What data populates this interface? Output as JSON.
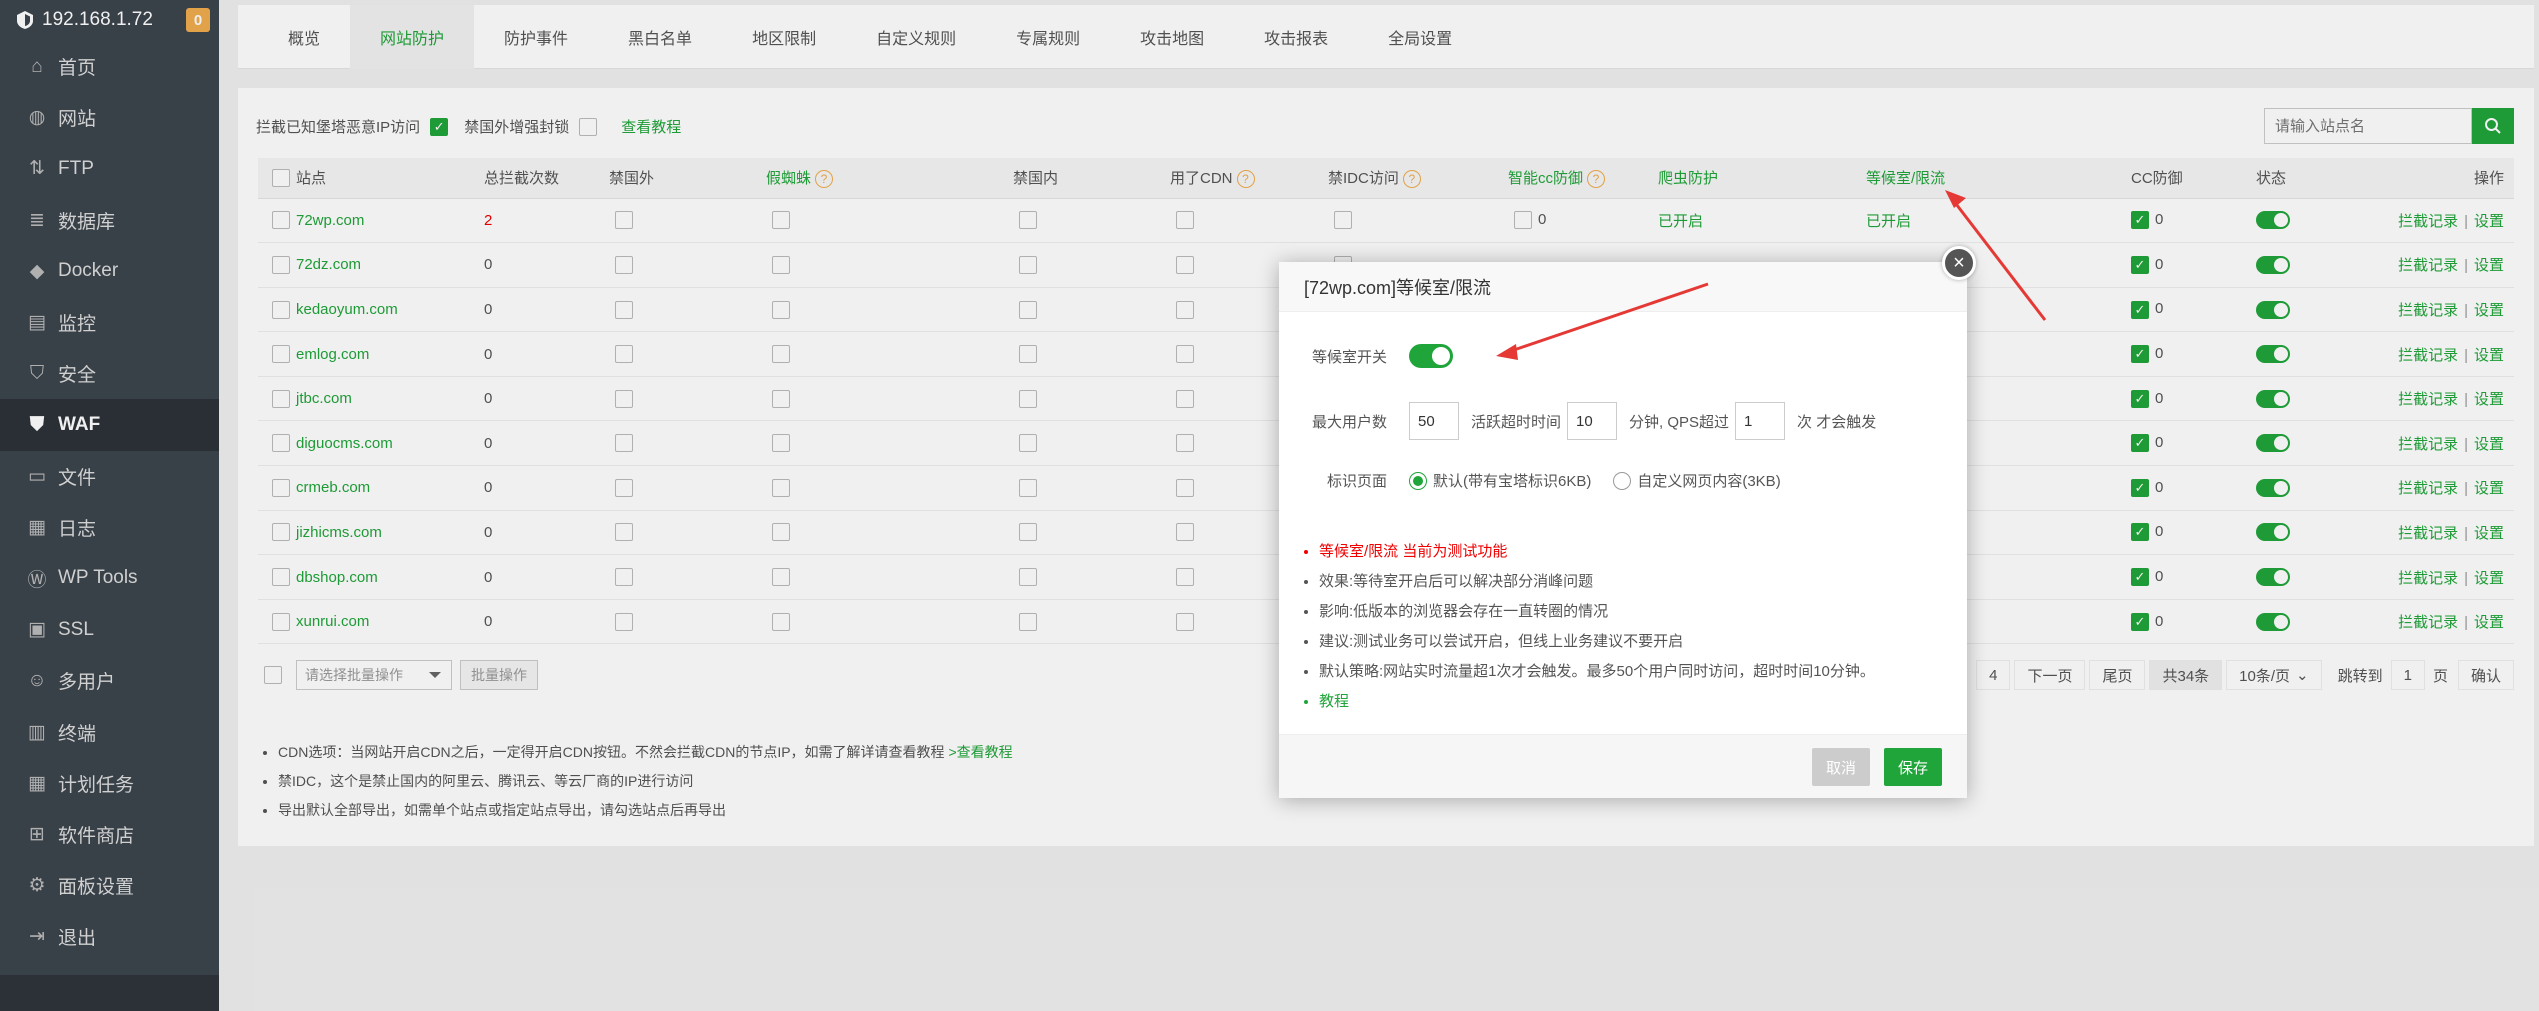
{
  "sidebar": {
    "host": "192.168.1.72",
    "badge": "0",
    "items": [
      {
        "label": "首页",
        "icon": "home-icon"
      },
      {
        "label": "网站",
        "icon": "globe-icon"
      },
      {
        "label": "FTP",
        "icon": "ftp-icon"
      },
      {
        "label": "数据库",
        "icon": "database-icon"
      },
      {
        "label": "Docker",
        "icon": "docker-icon"
      },
      {
        "label": "监控",
        "icon": "monitor-icon"
      },
      {
        "label": "安全",
        "icon": "shield-icon"
      },
      {
        "label": "WAF",
        "icon": "waf-icon"
      },
      {
        "label": "文件",
        "icon": "folder-icon"
      },
      {
        "label": "日志",
        "icon": "log-icon"
      },
      {
        "label": "WP Tools",
        "icon": "wordpress-icon"
      },
      {
        "label": "SSL",
        "icon": "ssl-icon"
      },
      {
        "label": "多用户",
        "icon": "users-icon"
      },
      {
        "label": "终端",
        "icon": "terminal-icon"
      },
      {
        "label": "计划任务",
        "icon": "calendar-icon"
      },
      {
        "label": "软件商店",
        "icon": "apps-icon"
      },
      {
        "label": "面板设置",
        "icon": "gear-icon"
      },
      {
        "label": "退出",
        "icon": "logout-icon"
      }
    ]
  },
  "tabs": [
    "概览",
    "网站防护",
    "防护事件",
    "黑白名单",
    "地区限制",
    "自定义规则",
    "专属规则",
    "攻击地图",
    "攻击报表",
    "全局设置"
  ],
  "toolbar": {
    "intercept_label": "拦截已知堡塔恶意IP访问",
    "overseas_label": "禁国外增强封锁",
    "tutorial_link": "查看教程",
    "search_placeholder": "请输入站点名"
  },
  "table": {
    "headers": [
      "站点",
      "总拦截次数",
      "禁国外",
      "假蜘蛛",
      "禁国内",
      "用了CDN",
      "禁IDC访问",
      "智能cc防御",
      "爬虫防护",
      "等候室/限流",
      "CC防御",
      "状态",
      "操作"
    ],
    "rows": [
      {
        "site": "72wp.com",
        "count": "2",
        "crawler": "已开启",
        "waiting": "已开启",
        "cc": "0",
        "smartcc": "0"
      },
      {
        "site": "72dz.com",
        "count": "0",
        "crawler": "",
        "waiting": "",
        "cc": "0",
        "smartcc": ""
      },
      {
        "site": "kedaoyum.com",
        "count": "0",
        "crawler": "",
        "waiting": "",
        "cc": "0",
        "smartcc": ""
      },
      {
        "site": "emlog.com",
        "count": "0",
        "crawler": "",
        "waiting": "",
        "cc": "0",
        "smartcc": ""
      },
      {
        "site": "jtbc.com",
        "count": "0",
        "crawler": "",
        "waiting": "",
        "cc": "0",
        "smartcc": ""
      },
      {
        "site": "diguocms.com",
        "count": "0",
        "crawler": "",
        "waiting": "",
        "cc": "0",
        "smartcc": ""
      },
      {
        "site": "crmeb.com",
        "count": "0",
        "crawler": "",
        "waiting": "",
        "cc": "0",
        "smartcc": ""
      },
      {
        "site": "jizhicms.com",
        "count": "0",
        "crawler": "",
        "waiting": "",
        "cc": "0",
        "smartcc": ""
      },
      {
        "site": "dbshop.com",
        "count": "0",
        "crawler": "",
        "waiting": "",
        "cc": "0",
        "smartcc": ""
      },
      {
        "site": "xunrui.com",
        "count": "0",
        "crawler": "",
        "waiting": "",
        "cc": "0",
        "smartcc": ""
      }
    ],
    "op_log": "拦截记录",
    "op_sep": "|",
    "op_settings": "设置"
  },
  "bottom": {
    "batch_placeholder": "请选择批量操作",
    "batch_button": "批量操作"
  },
  "pager": {
    "page": "4",
    "next": "下一页",
    "last": "尾页",
    "total": "共34条",
    "per_page": "10条/页",
    "jump_label": "跳转到",
    "jump_value": "1",
    "page_unit": "页",
    "confirm": "确认"
  },
  "notes": [
    "CDN选项：当网站开启CDN之后，一定得开启CDN按钮。不然会拦截CDN的节点IP，如需了解详请查看教程",
    "禁IDC，这个是禁止国内的阿里云、腾讯云、等云厂商的IP进行访问",
    "导出默认全部导出，如需单个站点或指定站点导出，请勾选站点后再导出"
  ],
  "notes_link": ">查看教程",
  "modal": {
    "title": "[72wp.com]等候室/限流",
    "close": "×",
    "switch_label": "等候室开关",
    "max_users_label": "最大用户数",
    "max_users_value": "50",
    "active_timeout_label": "活跃超时时间",
    "active_timeout_value": "10",
    "qps_label": "分钟, QPS超过",
    "qps_value": "1",
    "trigger_label": "次 才会触发",
    "page_label": "标识页面",
    "radio_default": "默认(带有宝塔标识6KB)",
    "radio_custom": "自定义网页内容(3KB)",
    "notes": [
      "等候室/限流 当前为测试功能",
      "效果:等待室开启后可以解决部分消峰问题",
      "影响:低版本的浏览器会存在一直转圈的情况",
      "建议:测试业务可以尝试开启，但线上业务建议不要开启",
      "默认策略:网站实时流量超1次才会触发。最多50个用户同时访问，超时时间10分钟。",
      "教程"
    ],
    "cancel": "取消",
    "save": "保存"
  },
  "colors": {
    "accent": "#20a53a",
    "sidebar_bg": "#3c444d",
    "warning": "#f0ad4e",
    "danger": "#e00"
  }
}
